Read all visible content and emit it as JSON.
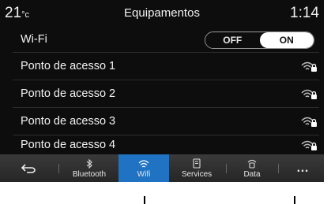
{
  "status": {
    "temperature": "21",
    "temperature_unit": "°c",
    "title": "Equipamentos",
    "time": "1:14"
  },
  "wifi": {
    "label": "Wi-Fi",
    "toggle_off": "OFF",
    "toggle_on": "ON",
    "state": "ON"
  },
  "access_points": [
    {
      "name": "Ponto de acesso 1",
      "icon": "wifi-lock-icon"
    },
    {
      "name": "Ponto de acesso 2",
      "icon": "wifi-lock-icon"
    },
    {
      "name": "Ponto de acesso 3",
      "icon": "wifi-lock-icon"
    },
    {
      "name": "Ponto de acesso 4",
      "icon": "wifi-lock-icon"
    }
  ],
  "navbar": {
    "back_icon": "back-arrow-icon",
    "bluetooth_label": "Bluetooth",
    "wifi_label": "Wifi",
    "services_label": "Services",
    "data_label": "Data",
    "more_label": "…",
    "active_tab": "Wifi",
    "active_color": "#1f73c2"
  }
}
